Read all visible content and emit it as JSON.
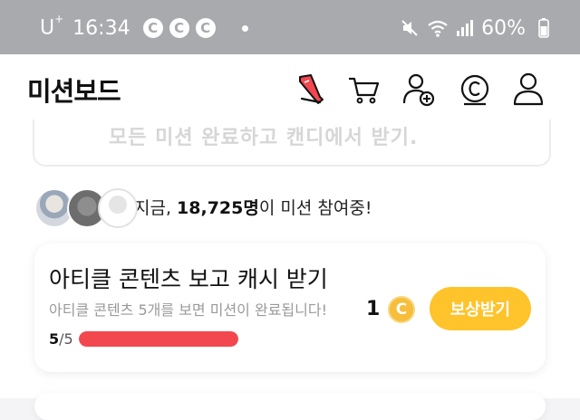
{
  "status_bar": {
    "carrier": "U",
    "carrier_sup": "+",
    "time": "16:34",
    "notification_letter": "C",
    "battery": "60%"
  },
  "header": {
    "title": "미션보드",
    "icons": [
      "shoe-icon",
      "cart-icon",
      "add-friend-icon",
      "coin-icon",
      "profile-icon"
    ]
  },
  "top_card": {
    "text_partial": "모든 미션 완료하고 캔디에서 받기."
  },
  "participants": {
    "prefix": "지금, ",
    "count": "18,725명",
    "suffix": "이 미션 참여중!"
  },
  "mission": {
    "title": "아티클 콘텐츠 보고 캐시 받기",
    "description": "아티클 콘텐츠 5개를 보면 미션이 완료됩니다!",
    "progress_current": "5",
    "progress_separator": "/",
    "progress_total": "5",
    "progress_fraction": 1.0,
    "reward_amount": "1",
    "coin_letter": "C",
    "button_label": "보상받기"
  },
  "colors": {
    "accent_yellow": "#ffc32b",
    "progress_red": "#f2474e",
    "status_bar_gray": "#a9aaad"
  }
}
